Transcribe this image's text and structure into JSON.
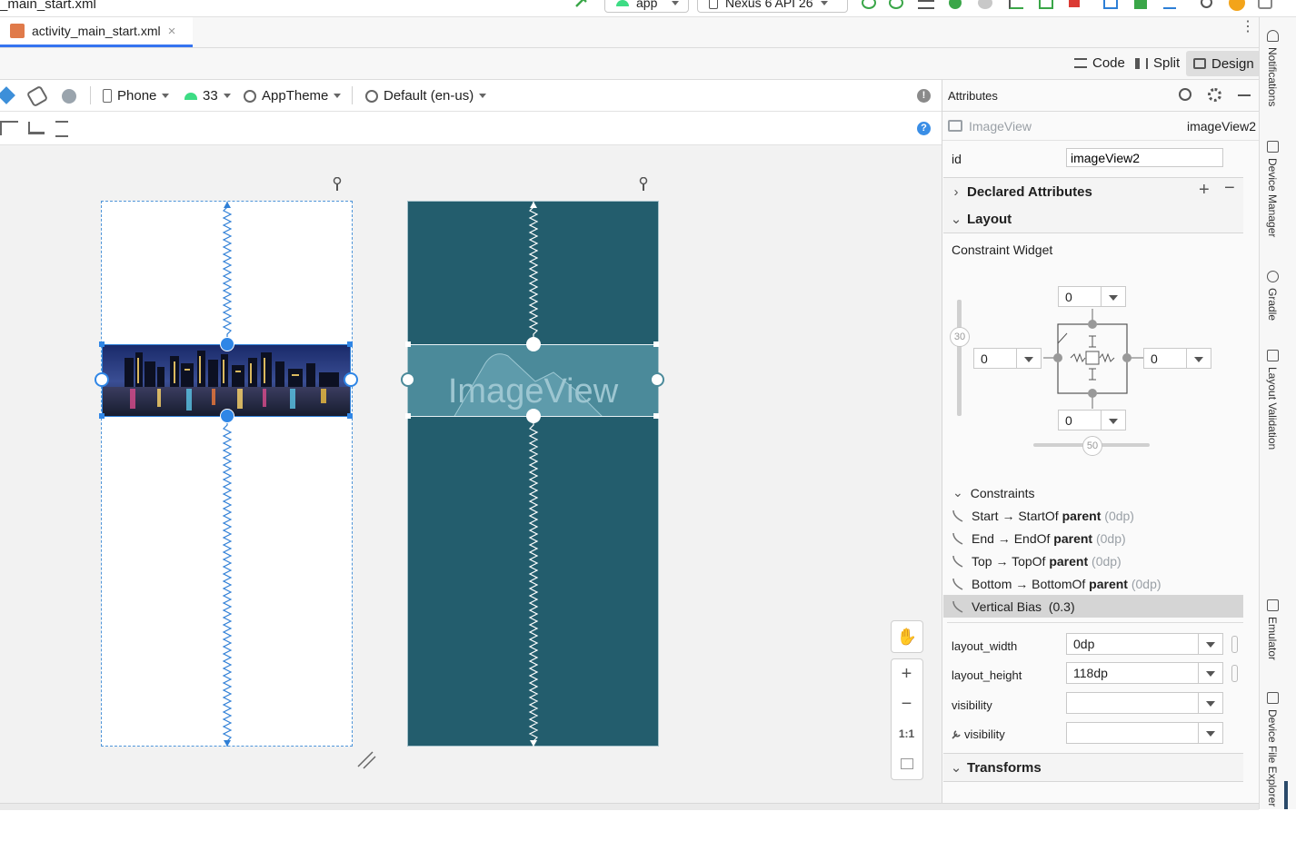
{
  "titlebar": {
    "file_title": "_main_start.xml",
    "run_config": "app",
    "device": "Nexus 6 API 26"
  },
  "editor_tab": {
    "label": "activity_main_start.xml",
    "close": "×"
  },
  "view_modes": {
    "code": "Code",
    "split": "Split",
    "design": "Design"
  },
  "design_toolbar": {
    "device_type": "Phone",
    "api_level": "33",
    "theme": "AppTheme",
    "locale": "Default (en-us)"
  },
  "canvas": {
    "blueprint_placeholder": "ImageView",
    "zoom": {
      "pan": "✋",
      "zoom_in": "+",
      "zoom_out": "−",
      "actual_size": "1:1"
    }
  },
  "attributes": {
    "panel_title": "Attributes",
    "component_type": "ImageView",
    "component_id": "imageView2",
    "id_label": "id",
    "id_value": "imageView2",
    "declared_header": "Declared Attributes",
    "layout_header": "Layout",
    "constraint_widget_label": "Constraint Widget",
    "margins": {
      "top": "0",
      "left": "0",
      "right": "0",
      "bottom": "0"
    },
    "bias": {
      "vertical": "30",
      "horizontal": "50"
    },
    "constraints_header": "Constraints",
    "constraints": [
      {
        "pre": "Start → StartOf ",
        "target": "parent",
        "margin": " (0dp)"
      },
      {
        "pre": "End → EndOf ",
        "target": "parent",
        "margin": " (0dp)"
      },
      {
        "pre": "Top → TopOf ",
        "target": "parent",
        "margin": " (0dp)"
      },
      {
        "pre": "Bottom → BottomOf ",
        "target": "parent",
        "margin": " (0dp)"
      },
      {
        "pre": "Vertical Bias ",
        "target": "",
        "margin": " (0.3)"
      }
    ],
    "layout_width_label": "layout_width",
    "layout_width_value": "0dp",
    "layout_height_label": "layout_height",
    "layout_height_value": "118dp",
    "visibility_label": "visibility",
    "tools_visibility_label": "visibility",
    "transforms_header": "Transforms"
  },
  "side_tabs": [
    "Notifications",
    "Device Manager",
    "Gradle",
    "Layout Validation",
    "Emulator",
    "Device File Explorer"
  ],
  "colors": {
    "accent": "#2196f3",
    "blueprint_bg": "#235d6d",
    "blueprint_image": "#4b8a9a",
    "selected_row": "#d5d5d5"
  }
}
